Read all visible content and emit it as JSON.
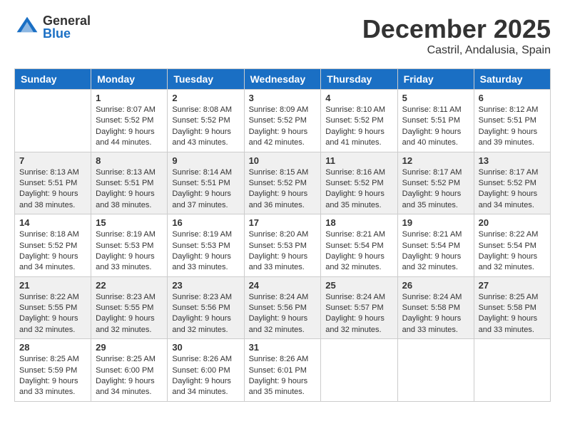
{
  "logo": {
    "general": "General",
    "blue": "Blue"
  },
  "title": "December 2025",
  "location": "Castril, Andalusia, Spain",
  "days_header": [
    "Sunday",
    "Monday",
    "Tuesday",
    "Wednesday",
    "Thursday",
    "Friday",
    "Saturday"
  ],
  "weeks": [
    [
      {
        "day": "",
        "info": ""
      },
      {
        "day": "1",
        "info": "Sunrise: 8:07 AM\nSunset: 5:52 PM\nDaylight: 9 hours\nand 44 minutes."
      },
      {
        "day": "2",
        "info": "Sunrise: 8:08 AM\nSunset: 5:52 PM\nDaylight: 9 hours\nand 43 minutes."
      },
      {
        "day": "3",
        "info": "Sunrise: 8:09 AM\nSunset: 5:52 PM\nDaylight: 9 hours\nand 42 minutes."
      },
      {
        "day": "4",
        "info": "Sunrise: 8:10 AM\nSunset: 5:52 PM\nDaylight: 9 hours\nand 41 minutes."
      },
      {
        "day": "5",
        "info": "Sunrise: 8:11 AM\nSunset: 5:51 PM\nDaylight: 9 hours\nand 40 minutes."
      },
      {
        "day": "6",
        "info": "Sunrise: 8:12 AM\nSunset: 5:51 PM\nDaylight: 9 hours\nand 39 minutes."
      }
    ],
    [
      {
        "day": "7",
        "info": "Sunrise: 8:13 AM\nSunset: 5:51 PM\nDaylight: 9 hours\nand 38 minutes."
      },
      {
        "day": "8",
        "info": "Sunrise: 8:13 AM\nSunset: 5:51 PM\nDaylight: 9 hours\nand 38 minutes."
      },
      {
        "day": "9",
        "info": "Sunrise: 8:14 AM\nSunset: 5:51 PM\nDaylight: 9 hours\nand 37 minutes."
      },
      {
        "day": "10",
        "info": "Sunrise: 8:15 AM\nSunset: 5:52 PM\nDaylight: 9 hours\nand 36 minutes."
      },
      {
        "day": "11",
        "info": "Sunrise: 8:16 AM\nSunset: 5:52 PM\nDaylight: 9 hours\nand 35 minutes."
      },
      {
        "day": "12",
        "info": "Sunrise: 8:17 AM\nSunset: 5:52 PM\nDaylight: 9 hours\nand 35 minutes."
      },
      {
        "day": "13",
        "info": "Sunrise: 8:17 AM\nSunset: 5:52 PM\nDaylight: 9 hours\nand 34 minutes."
      }
    ],
    [
      {
        "day": "14",
        "info": "Sunrise: 8:18 AM\nSunset: 5:52 PM\nDaylight: 9 hours\nand 34 minutes."
      },
      {
        "day": "15",
        "info": "Sunrise: 8:19 AM\nSunset: 5:53 PM\nDaylight: 9 hours\nand 33 minutes."
      },
      {
        "day": "16",
        "info": "Sunrise: 8:19 AM\nSunset: 5:53 PM\nDaylight: 9 hours\nand 33 minutes."
      },
      {
        "day": "17",
        "info": "Sunrise: 8:20 AM\nSunset: 5:53 PM\nDaylight: 9 hours\nand 33 minutes."
      },
      {
        "day": "18",
        "info": "Sunrise: 8:21 AM\nSunset: 5:54 PM\nDaylight: 9 hours\nand 32 minutes."
      },
      {
        "day": "19",
        "info": "Sunrise: 8:21 AM\nSunset: 5:54 PM\nDaylight: 9 hours\nand 32 minutes."
      },
      {
        "day": "20",
        "info": "Sunrise: 8:22 AM\nSunset: 5:54 PM\nDaylight: 9 hours\nand 32 minutes."
      }
    ],
    [
      {
        "day": "21",
        "info": "Sunrise: 8:22 AM\nSunset: 5:55 PM\nDaylight: 9 hours\nand 32 minutes."
      },
      {
        "day": "22",
        "info": "Sunrise: 8:23 AM\nSunset: 5:55 PM\nDaylight: 9 hours\nand 32 minutes."
      },
      {
        "day": "23",
        "info": "Sunrise: 8:23 AM\nSunset: 5:56 PM\nDaylight: 9 hours\nand 32 minutes."
      },
      {
        "day": "24",
        "info": "Sunrise: 8:24 AM\nSunset: 5:56 PM\nDaylight: 9 hours\nand 32 minutes."
      },
      {
        "day": "25",
        "info": "Sunrise: 8:24 AM\nSunset: 5:57 PM\nDaylight: 9 hours\nand 32 minutes."
      },
      {
        "day": "26",
        "info": "Sunrise: 8:24 AM\nSunset: 5:58 PM\nDaylight: 9 hours\nand 33 minutes."
      },
      {
        "day": "27",
        "info": "Sunrise: 8:25 AM\nSunset: 5:58 PM\nDaylight: 9 hours\nand 33 minutes."
      }
    ],
    [
      {
        "day": "28",
        "info": "Sunrise: 8:25 AM\nSunset: 5:59 PM\nDaylight: 9 hours\nand 33 minutes."
      },
      {
        "day": "29",
        "info": "Sunrise: 8:25 AM\nSunset: 6:00 PM\nDaylight: 9 hours\nand 34 minutes."
      },
      {
        "day": "30",
        "info": "Sunrise: 8:26 AM\nSunset: 6:00 PM\nDaylight: 9 hours\nand 34 minutes."
      },
      {
        "day": "31",
        "info": "Sunrise: 8:26 AM\nSunset: 6:01 PM\nDaylight: 9 hours\nand 35 minutes."
      },
      {
        "day": "",
        "info": ""
      },
      {
        "day": "",
        "info": ""
      },
      {
        "day": "",
        "info": ""
      }
    ]
  ]
}
